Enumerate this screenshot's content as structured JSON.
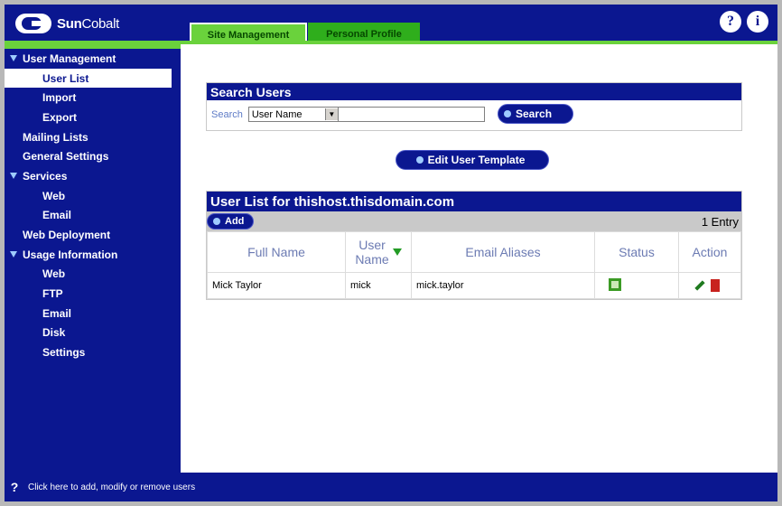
{
  "brand": {
    "name_bold": "Sun",
    "name_regular": "Cobalt"
  },
  "tabs": [
    {
      "label": "Site Management",
      "active": true
    },
    {
      "label": "Personal Profile",
      "active": false
    }
  ],
  "header_icons": [
    {
      "glyph": "?",
      "icon": "help-icon"
    },
    {
      "glyph": "i",
      "icon": "info-icon"
    }
  ],
  "sidebar": {
    "items": [
      {
        "label": "User Management",
        "level": "head",
        "icon": "triangle-down-icon"
      },
      {
        "label": "User List",
        "level": "l2",
        "selected": true
      },
      {
        "label": "Import",
        "level": "l2"
      },
      {
        "label": "Export",
        "level": "l2"
      },
      {
        "label": "Mailing Lists",
        "level": "l1"
      },
      {
        "label": "General Settings",
        "level": "l1"
      },
      {
        "label": "Services",
        "level": "head",
        "icon": "triangle-down-icon"
      },
      {
        "label": "Web",
        "level": "l2"
      },
      {
        "label": "Email",
        "level": "l2"
      },
      {
        "label": "Web Deployment",
        "level": "l1"
      },
      {
        "label": "Usage Information",
        "level": "head",
        "icon": "triangle-down-icon"
      },
      {
        "label": "Web",
        "level": "l2"
      },
      {
        "label": "FTP",
        "level": "l2"
      },
      {
        "label": "Email",
        "level": "l2"
      },
      {
        "label": "Disk",
        "level": "l2"
      },
      {
        "label": "Settings",
        "level": "l2"
      }
    ]
  },
  "search": {
    "title": "Search Users",
    "label": "Search",
    "field_selected": "User Name",
    "query_value": "",
    "button_label": "Search"
  },
  "edit_template_label": "Edit User Template",
  "userlist": {
    "title": "User List for thishost.thisdomain.com",
    "add_label": "Add",
    "entry_count": "1 Entry",
    "columns": [
      "Full Name",
      "User Name",
      "Email Aliases",
      "Status",
      "Action"
    ],
    "column_user_name_lines": [
      "User",
      "Name"
    ],
    "rows": [
      {
        "full_name": "Mick Taylor",
        "user_name": "mick",
        "email_aliases": "mick.taylor"
      }
    ]
  },
  "status_bar": {
    "message": "Click here to add, modify or remove users"
  },
  "colors": {
    "navy": "#0b1790",
    "green": "#6ad23c",
    "grey": "#c9c9c9"
  }
}
